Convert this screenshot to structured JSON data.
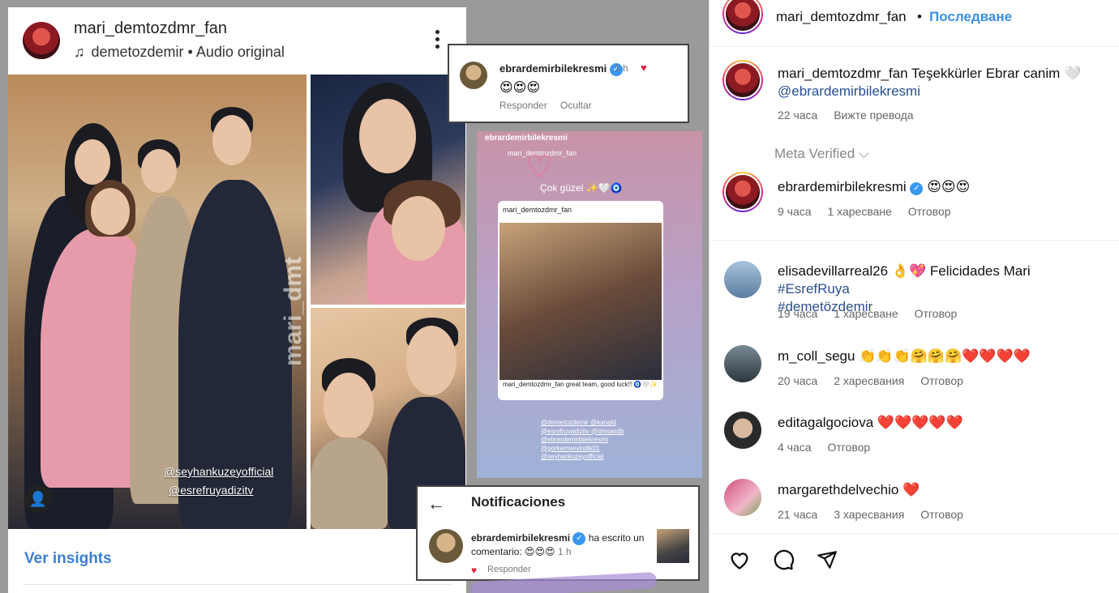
{
  "collage": {
    "post": {
      "username": "mari_demtozdmr_fan",
      "audio": "demetozdemir • Audio original",
      "watermark": "mari_dmt",
      "tags": [
        "@seyhankuzeyofficial",
        "@esrefruyadizitv"
      ],
      "insights_label": "Ver insights"
    },
    "comment_popup": {
      "username": "ebrardemirbilekresmi",
      "time": "1 h",
      "emojis": "😍😍😍",
      "reply_label": "Responder",
      "hide_label": "Ocultar"
    },
    "story": {
      "username": "ebrardemirbilekresmi",
      "sub_username": "mari_demtozdmr_fan",
      "caption": "Çok güzel ✨🤍🧿",
      "post_username": "mari_demtozdmr_fan",
      "post_caption": "mari_demtozdmr_fan great team, good luck!! 🧿🤍✨",
      "tags": [
        "@demetozdemir @kanald",
        "@esrefruyadizitv @timsandb",
        "@ebrardemirbilekresmi",
        "@gorkemsevindik01",
        "@seyhankuzeyofficial"
      ]
    },
    "notifications": {
      "title": "Notificaciones",
      "username": "ebrardemirbilekresmi",
      "text": "ha escrito un comentario: 😍😍😍",
      "time": "1 h",
      "reply_label": "Responder"
    }
  },
  "panel": {
    "header": {
      "username": "mari_demtozdmr_fan",
      "dot": "•",
      "follow_label": "Последване"
    },
    "caption": {
      "username": "mari_demtozdmr_fan",
      "text": "Teşekkürler Ebrar canim 🤍",
      "mention": "@ebrardemirbilekresmi",
      "time": "22 часа",
      "translate": "Вижте превода"
    },
    "meta_verified": "Meta Verified ⌵",
    "comments": [
      {
        "username": "ebrardemirbilekresmi",
        "text": "😍😍😍",
        "time": "9 часа",
        "likes": "1 харесване",
        "reply": "Отговор"
      },
      {
        "username": "elisadevillarreal26",
        "text": "👌💖 Felicidades Mari",
        "hashtag1": "#EsrefRuya",
        "hashtag2": "#demetözdemir",
        "time": "19 часа",
        "likes": "1 харесване",
        "reply": "Отговор"
      },
      {
        "username": "m_coll_segu",
        "text": "👏👏👏🤗🤗🤗❤️❤️❤️❤️",
        "time": "20 часа",
        "likes": "2 харесвания",
        "reply": "Отговор"
      },
      {
        "username": "editagalgociova",
        "text": "❤️❤️❤️❤️❤️",
        "time": "4 часа",
        "reply": "Отговор"
      },
      {
        "username": "margarethdelvechio",
        "text": "❤️",
        "time": "21 часа",
        "likes": "3 харесвания",
        "reply": "Отговор"
      }
    ],
    "actions": [
      "heart-icon",
      "comment-icon",
      "share-icon"
    ],
    "colors": {
      "link_blue": "#3b8fe6",
      "verified_blue": "#3897f0"
    }
  }
}
